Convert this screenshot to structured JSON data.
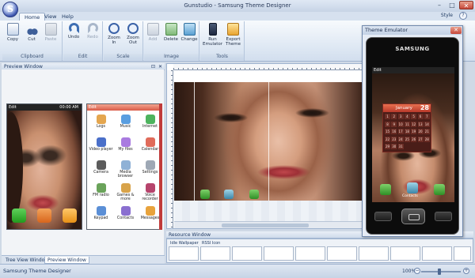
{
  "window": {
    "title": "Gunstudio - Samsung Theme Designer",
    "min_glyph": "–",
    "max_glyph": "□",
    "close_glyph": "✕",
    "orb_letter": "S"
  },
  "ribbon": {
    "tabs": [
      {
        "label": "Home",
        "active": true
      },
      {
        "label": "View",
        "active": false
      },
      {
        "label": "Help",
        "active": false
      }
    ],
    "style_label": "Style",
    "help_glyph": "?",
    "groups": [
      {
        "label": "Clipboard",
        "buttons": [
          {
            "label": "Copy",
            "icon": "copy-icon",
            "enabled": true
          },
          {
            "label": "Cut",
            "icon": "cut-icon",
            "enabled": true
          },
          {
            "label": "Paste",
            "icon": "paste-icon",
            "enabled": false
          }
        ]
      },
      {
        "label": "Edit",
        "buttons": [
          {
            "label": "Undo",
            "icon": "undo-icon",
            "enabled": true
          },
          {
            "label": "Redo",
            "icon": "redo-icon",
            "enabled": false
          }
        ]
      },
      {
        "label": "Scale",
        "buttons": [
          {
            "label": "Zoom In",
            "icon": "zoom-in-icon",
            "enabled": true
          },
          {
            "label": "Zoom Out",
            "icon": "zoom-out-icon",
            "enabled": true
          }
        ]
      },
      {
        "label": "Image",
        "buttons": [
          {
            "label": "Add",
            "icon": "add-image-icon",
            "enabled": false
          },
          {
            "label": "Delete",
            "icon": "delete-image-icon",
            "enabled": true
          },
          {
            "label": "Change",
            "icon": "change-image-icon",
            "enabled": true
          }
        ]
      },
      {
        "label": "Tools",
        "buttons": [
          {
            "label": "Run Emulator",
            "icon": "run-emulator-icon",
            "enabled": true
          },
          {
            "label": "Export Theme",
            "icon": "export-theme-icon",
            "enabled": true
          }
        ]
      }
    ]
  },
  "preview_window": {
    "title": "Preview Window",
    "pin_glyph": "⊡",
    "close_glyph": "✕",
    "status_text": "Edit",
    "time_text": "00:00 AM",
    "menu_items": [
      "Logs",
      "Music",
      "Internet",
      "Video player",
      "My files",
      "Calendar",
      "Camera",
      "Media browser",
      "Settings",
      "FM radio",
      "Games & more",
      "Voice recorder",
      "Keypad",
      "Contacts",
      "Messages"
    ],
    "bottom_tabs": [
      {
        "label": "Tree View Window",
        "active": false
      },
      {
        "label": "Preview Window",
        "active": true
      }
    ]
  },
  "resource_window": {
    "title": "Resource Window",
    "items": [
      "Idle Wallpaper",
      "RSSI Icon"
    ]
  },
  "emulator": {
    "title": "Theme Emulator",
    "brand": "SAMSUNG",
    "edit_label": "Edit",
    "calendar_month": "January",
    "calendar_day": "28",
    "calendar_days": [
      "1",
      "2",
      "3",
      "4",
      "5",
      "6",
      "7",
      "8",
      "9",
      "10",
      "11",
      "12",
      "13",
      "14",
      "15",
      "16",
      "17",
      "18",
      "19",
      "20",
      "21",
      "22",
      "23",
      "24",
      "25",
      "26",
      "27",
      "28",
      "29",
      "30",
      "31"
    ],
    "dock_label": "Contacts",
    "close_glyph": "✕"
  },
  "statusbar": {
    "text": "Samsung Theme Designer",
    "zoom": "100%",
    "zoom_minus": "−",
    "zoom_plus": "+"
  }
}
